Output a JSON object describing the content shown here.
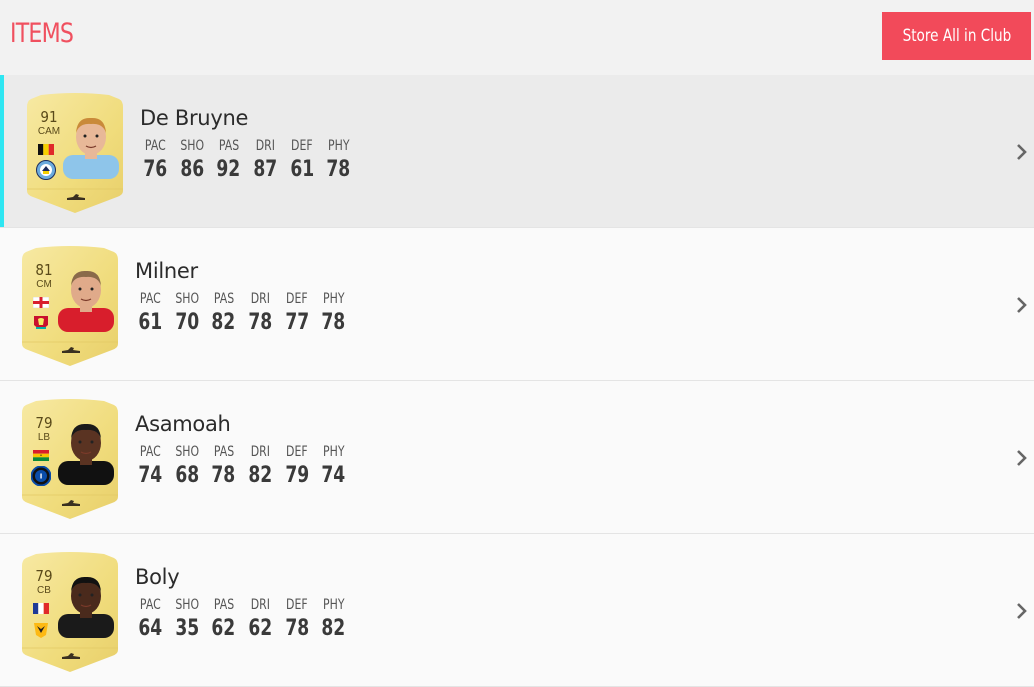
{
  "header": {
    "title": "ITEMS",
    "store_button_label": "Store All in Club"
  },
  "stat_labels": [
    "PAC",
    "SHO",
    "PAS",
    "DRI",
    "DEF",
    "PHY"
  ],
  "players": [
    {
      "name": "De Bruyne",
      "rating": "91",
      "position": "CAM",
      "stats": [
        "76",
        "86",
        "92",
        "87",
        "61",
        "78"
      ],
      "flag": "belgium-flag",
      "club": "manchester-city-crest",
      "selected": true
    },
    {
      "name": "Milner",
      "rating": "81",
      "position": "CM",
      "stats": [
        "61",
        "70",
        "82",
        "78",
        "77",
        "78"
      ],
      "flag": "england-flag",
      "club": "liverpool-crest",
      "selected": false
    },
    {
      "name": "Asamoah",
      "rating": "79",
      "position": "LB",
      "stats": [
        "74",
        "68",
        "78",
        "82",
        "79",
        "74"
      ],
      "flag": "ghana-flag",
      "club": "inter-crest",
      "selected": false
    },
    {
      "name": "Boly",
      "rating": "79",
      "position": "CB",
      "stats": [
        "64",
        "35",
        "62",
        "62",
        "78",
        "82"
      ],
      "flag": "france-flag",
      "club": "wolves-crest",
      "selected": false
    }
  ],
  "colors": {
    "accent": "#f0505f",
    "button": "#f24a5a",
    "selected_bar": "#2ee6f2",
    "card_gold": "#f3e08a"
  }
}
